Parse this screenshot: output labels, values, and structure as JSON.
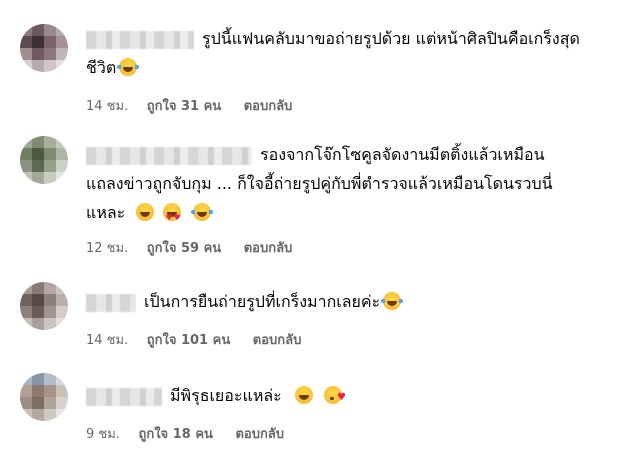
{
  "comments": [
    {
      "text_lines": [
        "รูปนี้แฟนคลับมาขอถ่ายรูปด้วย แต่หน้าศิลปินคือเกร็งสุด",
        "ชีวิต"
      ],
      "time": "14 ชม.",
      "likes": "ถูกใจ 31 คน",
      "reply": "ตอบกลับ"
    },
    {
      "text_lines": [
        "รองจากโจ๊กโซคูลจัดงานมีตติ้งแล้วเหมือน",
        "แถลงข่าวถูกจับกุม ... ก็ใจอี้ถ่ายรูปคู่กับพี่ตำรวจแล้วเหมือนโดนรวบนี่",
        "แหละ"
      ],
      "time": "12 ชม.",
      "likes": "ถูกใจ 59 คน",
      "reply": "ตอบกลับ"
    },
    {
      "text_lines": [
        "เป็นการยืนถ่ายรูปที่เกร็งมากเลยค่ะ"
      ],
      "time": "14 ชม.",
      "likes": "ถูกใจ 101 คน",
      "reply": "ตอบกลับ"
    },
    {
      "text_lines": [
        "มีพิรุธเยอะแหล่ะ"
      ],
      "time": "9 ชม.",
      "likes": "ถูกใจ 18 คน",
      "reply": "ตอบกลับ"
    }
  ],
  "icons": {
    "comment_1": [
      "laughing-tears-emoji-icon"
    ],
    "comment_2": [
      "laughing-emoji-icon",
      "heart-eyes-emoji-icon",
      "laughing-tears-emoji-icon"
    ],
    "comment_3": [
      "laughing-tears-emoji-icon"
    ],
    "comment_4": [
      "grinning-emoji-icon",
      "kissing-heart-emoji-icon"
    ]
  },
  "colors": {
    "text": "#050505",
    "meta": "#65676b",
    "emoji_yellow": "#f7b22c",
    "heart_red": "#e8234a"
  }
}
